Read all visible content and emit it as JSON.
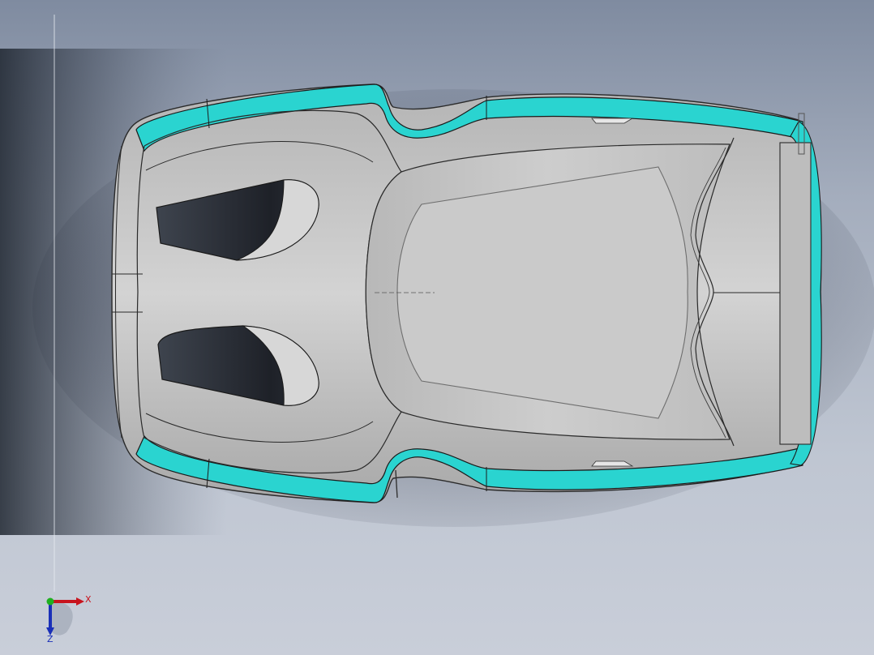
{
  "viewport": {
    "background_top": "#7f8ba0",
    "background_bottom": "#c9ced9"
  },
  "model": {
    "body_color": "#c4c4c4",
    "trim_color": "#2ad4d0",
    "edge_color": "#2a2a2a",
    "opening_color": "#2c3038"
  },
  "triad": {
    "x_label": "X",
    "z_label": "Z",
    "x_color": "#c8141e",
    "y_color": "#1fb01f",
    "z_color": "#1a2fb8"
  }
}
